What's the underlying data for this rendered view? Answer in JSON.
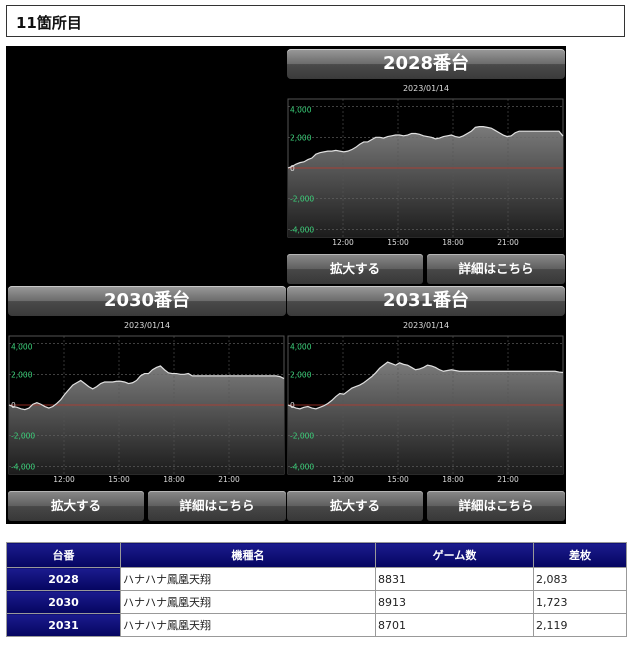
{
  "heading": "11箇所目",
  "buttons": {
    "zoom": "拡大する",
    "detail": "詳細はこちら"
  },
  "chart_data": [
    {
      "type": "area",
      "title": "2028番台",
      "subtitle": "2023/01/14",
      "ylim": [
        -4500,
        4500
      ],
      "yticks": [
        4000,
        2000,
        0,
        -2000,
        -4000
      ],
      "ytick_labels": [
        "4,000",
        "2,000",
        "0",
        "-2,000",
        "-4,000"
      ],
      "xticks": [
        "12:00",
        "15:00",
        "18:00",
        "21:00"
      ],
      "x": [
        0,
        1,
        2,
        3,
        4,
        5,
        6,
        7,
        8,
        9,
        10,
        11,
        12,
        13,
        14,
        15,
        16,
        17,
        18,
        19,
        20,
        21,
        22,
        23,
        24,
        25,
        26,
        27,
        28,
        29,
        30,
        31,
        32,
        33,
        34,
        35,
        36,
        37,
        38,
        39,
        40,
        41,
        42,
        43,
        44,
        45,
        46,
        47,
        48,
        49,
        50,
        51,
        52,
        53,
        54,
        55,
        56,
        57,
        58,
        59,
        60,
        61,
        62,
        63,
        64,
        65,
        66,
        67,
        68,
        69
      ],
      "values": [
        0,
        100,
        250,
        350,
        400,
        550,
        650,
        900,
        1000,
        1050,
        1100,
        1100,
        1150,
        1100,
        1050,
        1100,
        1200,
        1350,
        1550,
        1700,
        1700,
        1850,
        2000,
        2000,
        1950,
        2050,
        2100,
        2150,
        2150,
        2100,
        2150,
        2250,
        2250,
        2200,
        2100,
        2050,
        2000,
        1900,
        1950,
        2050,
        2100,
        2150,
        2050,
        2000,
        2100,
        2250,
        2400,
        2650,
        2700,
        2700,
        2650,
        2600,
        2450,
        2300,
        2150,
        2050,
        2100,
        2300,
        2400,
        2400,
        2400,
        2400,
        2400,
        2400,
        2400,
        2400,
        2400,
        2400,
        2400,
        2083
      ],
      "stroke": "#e0e0e0",
      "zero_line": "#c0392b"
    },
    {
      "type": "area",
      "title": "2030番台",
      "subtitle": "2023/01/14",
      "ylim": [
        -4500,
        4500
      ],
      "yticks": [
        4000,
        2000,
        0,
        -2000,
        -4000
      ],
      "ytick_labels": [
        "4,000",
        "2,000",
        "0",
        "-2,000",
        "-4,000"
      ],
      "xticks": [
        "12:00",
        "15:00",
        "18:00",
        "21:00"
      ],
      "x": [
        0,
        1,
        2,
        3,
        4,
        5,
        6,
        7,
        8,
        9,
        10,
        11,
        12,
        13,
        14,
        15,
        16,
        17,
        18,
        19,
        20,
        21,
        22,
        23,
        24,
        25,
        26,
        27,
        28,
        29,
        30,
        31,
        32,
        33,
        34,
        35,
        36,
        37,
        38,
        39,
        40,
        41,
        42,
        43,
        44,
        45,
        46,
        47,
        48,
        49,
        50,
        51,
        52,
        53,
        54,
        55,
        56,
        57,
        58,
        59,
        60,
        61,
        62,
        63,
        64,
        65,
        66,
        67,
        68,
        69
      ],
      "values": [
        0,
        -100,
        -150,
        -250,
        -300,
        -200,
        50,
        150,
        50,
        -100,
        -200,
        -100,
        100,
        350,
        700,
        1000,
        1300,
        1450,
        1600,
        1400,
        1200,
        1050,
        1200,
        1400,
        1500,
        1500,
        1500,
        1550,
        1550,
        1500,
        1400,
        1450,
        1600,
        1900,
        2050,
        2050,
        2300,
        2450,
        2550,
        2300,
        2100,
        2050,
        2050,
        2000,
        2000,
        2050,
        1900,
        1900,
        1900,
        1900,
        1900,
        1900,
        1900,
        1900,
        1900,
        1900,
        1900,
        1900,
        1900,
        1900,
        1900,
        1900,
        1900,
        1900,
        1900,
        1900,
        1900,
        1900,
        1850,
        1723
      ],
      "stroke": "#e0e0e0",
      "zero_line": "#c0392b"
    },
    {
      "type": "area",
      "title": "2031番台",
      "subtitle": "2023/01/14",
      "ylim": [
        -4500,
        4500
      ],
      "yticks": [
        4000,
        2000,
        0,
        -2000,
        -4000
      ],
      "ytick_labels": [
        "4,000",
        "2,000",
        "0",
        "-2,000",
        "-4,000"
      ],
      "xticks": [
        "12:00",
        "15:00",
        "18:00",
        "21:00"
      ],
      "x": [
        0,
        1,
        2,
        3,
        4,
        5,
        6,
        7,
        8,
        9,
        10,
        11,
        12,
        13,
        14,
        15,
        16,
        17,
        18,
        19,
        20,
        21,
        22,
        23,
        24,
        25,
        26,
        27,
        28,
        29,
        30,
        31,
        32,
        33,
        34,
        35,
        36,
        37,
        38,
        39,
        40,
        41,
        42,
        43,
        44,
        45,
        46,
        47,
        48,
        49,
        50,
        51,
        52,
        53,
        54,
        55,
        56,
        57,
        58,
        59,
        60,
        61,
        62,
        63,
        64,
        65,
        66,
        67,
        68,
        69
      ],
      "values": [
        0,
        -100,
        -200,
        -250,
        -150,
        -100,
        -200,
        -250,
        -150,
        -50,
        100,
        300,
        550,
        750,
        700,
        900,
        1100,
        1200,
        1300,
        1450,
        1650,
        1850,
        2100,
        2400,
        2600,
        2800,
        2700,
        2600,
        2750,
        2650,
        2600,
        2450,
        2300,
        2350,
        2450,
        2600,
        2550,
        2450,
        2300,
        2200,
        2250,
        2300,
        2250,
        2200,
        2200,
        2200,
        2200,
        2200,
        2200,
        2200,
        2200,
        2200,
        2200,
        2200,
        2200,
        2200,
        2200,
        2200,
        2200,
        2200,
        2200,
        2200,
        2200,
        2200,
        2200,
        2200,
        2200,
        2200,
        2150,
        2119
      ],
      "stroke": "#e0e0e0",
      "zero_line": "#c0392b"
    }
  ],
  "table": {
    "headers": [
      "台番",
      "機種名",
      "ゲーム数",
      "差枚"
    ],
    "rows": [
      [
        "2028",
        "ハナハナ鳳凰天翔",
        "8831",
        "2,083"
      ],
      [
        "2030",
        "ハナハナ鳳凰天翔",
        "8913",
        "1,723"
      ],
      [
        "2031",
        "ハナハナ鳳凰天翔",
        "8701",
        "2,119"
      ]
    ]
  }
}
